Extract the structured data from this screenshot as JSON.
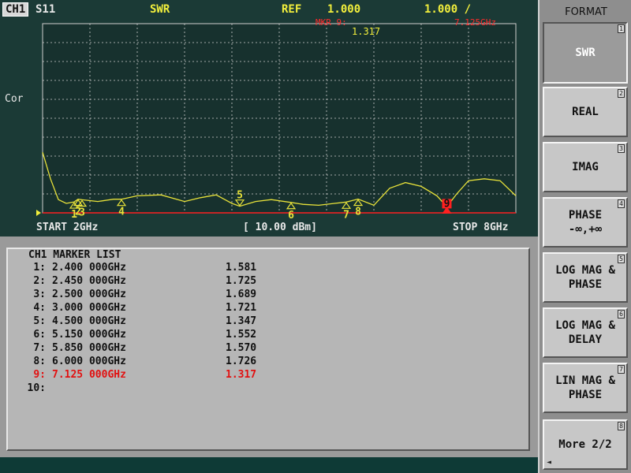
{
  "header": {
    "channel": "CH1",
    "measurement": "S11",
    "format": "SWR",
    "ref_label": "REF",
    "ref_value": "1.000",
    "scale": "1.000 /",
    "marker_readout": "MKR 9:",
    "marker_freq": "7.125GHz",
    "marker_value": "1.317"
  },
  "side_label": "Cor",
  "footer": {
    "start": "START 2GHz",
    "power": "[ 10.00 dBm]",
    "stop": "STOP 8GHz"
  },
  "chart_data": {
    "type": "line",
    "xlim": [
      2,
      8
    ],
    "ylim": [
      1,
      11
    ],
    "grid": true,
    "colors": {
      "trace": "#e8e23a",
      "reference": "#ff2020",
      "grid": "#cfcfcf",
      "active_marker": "#ff2020"
    },
    "series": [
      {
        "x": [
          2.0,
          2.1,
          2.2,
          2.3,
          2.4,
          2.45,
          2.5,
          2.7,
          2.9,
          3.0,
          3.2,
          3.5,
          3.8,
          4.0,
          4.2,
          4.4,
          4.5,
          4.7,
          4.9,
          5.15,
          5.3,
          5.5,
          5.7,
          5.85,
          6.0,
          6.2,
          6.4,
          6.6,
          6.8,
          7.0,
          7.125,
          7.25,
          7.4,
          7.6,
          7.8,
          8.0
        ],
        "y": [
          4.2,
          2.8,
          1.7,
          1.5,
          1.58,
          1.72,
          1.69,
          1.6,
          1.72,
          1.72,
          1.9,
          1.95,
          1.6,
          1.8,
          1.95,
          1.5,
          1.35,
          1.6,
          1.7,
          1.55,
          1.45,
          1.4,
          1.5,
          1.57,
          1.73,
          1.4,
          2.3,
          2.6,
          2.4,
          1.9,
          1.32,
          2.0,
          2.7,
          2.8,
          2.7,
          1.9
        ]
      }
    ],
    "reference_level": 1.0,
    "markers": [
      {
        "id": "1",
        "x": 2.4,
        "y": 1.581
      },
      {
        "id": "2",
        "x": 2.45,
        "y": 1.725
      },
      {
        "id": "3",
        "x": 2.5,
        "y": 1.689
      },
      {
        "id": "4",
        "x": 3.0,
        "y": 1.721
      },
      {
        "id": "5",
        "x": 4.5,
        "y": 1.347
      },
      {
        "id": "6",
        "x": 5.15,
        "y": 1.552
      },
      {
        "id": "7",
        "x": 5.85,
        "y": 1.57
      },
      {
        "id": "8",
        "x": 6.0,
        "y": 1.726
      },
      {
        "id": "9",
        "x": 7.125,
        "y": 1.317,
        "active": true
      }
    ]
  },
  "marker_list": {
    "title": "CH1 MARKER LIST",
    "rows": [
      {
        "num": "1:",
        "freq": "2.400 000GHz",
        "value": "1.581"
      },
      {
        "num": "2:",
        "freq": "2.450 000GHz",
        "value": "1.725"
      },
      {
        "num": "3:",
        "freq": "2.500 000GHz",
        "value": "1.689"
      },
      {
        "num": "4:",
        "freq": "3.000 000GHz",
        "value": "1.721"
      },
      {
        "num": "5:",
        "freq": "4.500 000GHz",
        "value": "1.347"
      },
      {
        "num": "6:",
        "freq": "5.150 000GHz",
        "value": "1.552"
      },
      {
        "num": "7:",
        "freq": "5.850 000GHz",
        "value": "1.570"
      },
      {
        "num": "8:",
        "freq": "6.000 000GHz",
        "value": "1.726"
      },
      {
        "num": "9:",
        "freq": "7.125 000GHz",
        "value": "1.317",
        "active": true
      },
      {
        "num": "10:",
        "freq": "",
        "value": ""
      }
    ]
  },
  "menu": {
    "title": "FORMAT",
    "keys": [
      {
        "label": "SWR",
        "num": "1",
        "selected": true
      },
      {
        "label": "REAL",
        "num": "2"
      },
      {
        "label": "IMAG",
        "num": "3"
      },
      {
        "label": "PHASE\n-∞,+∞",
        "num": "4"
      },
      {
        "label": "LOG MAG &\nPHASE",
        "num": "5"
      },
      {
        "label": "LOG MAG &\nDELAY",
        "num": "6"
      },
      {
        "label": "LIN MAG &\nPHASE",
        "num": "7"
      },
      {
        "label": "More 2/2",
        "num": "8",
        "arrow": "◄"
      }
    ]
  }
}
